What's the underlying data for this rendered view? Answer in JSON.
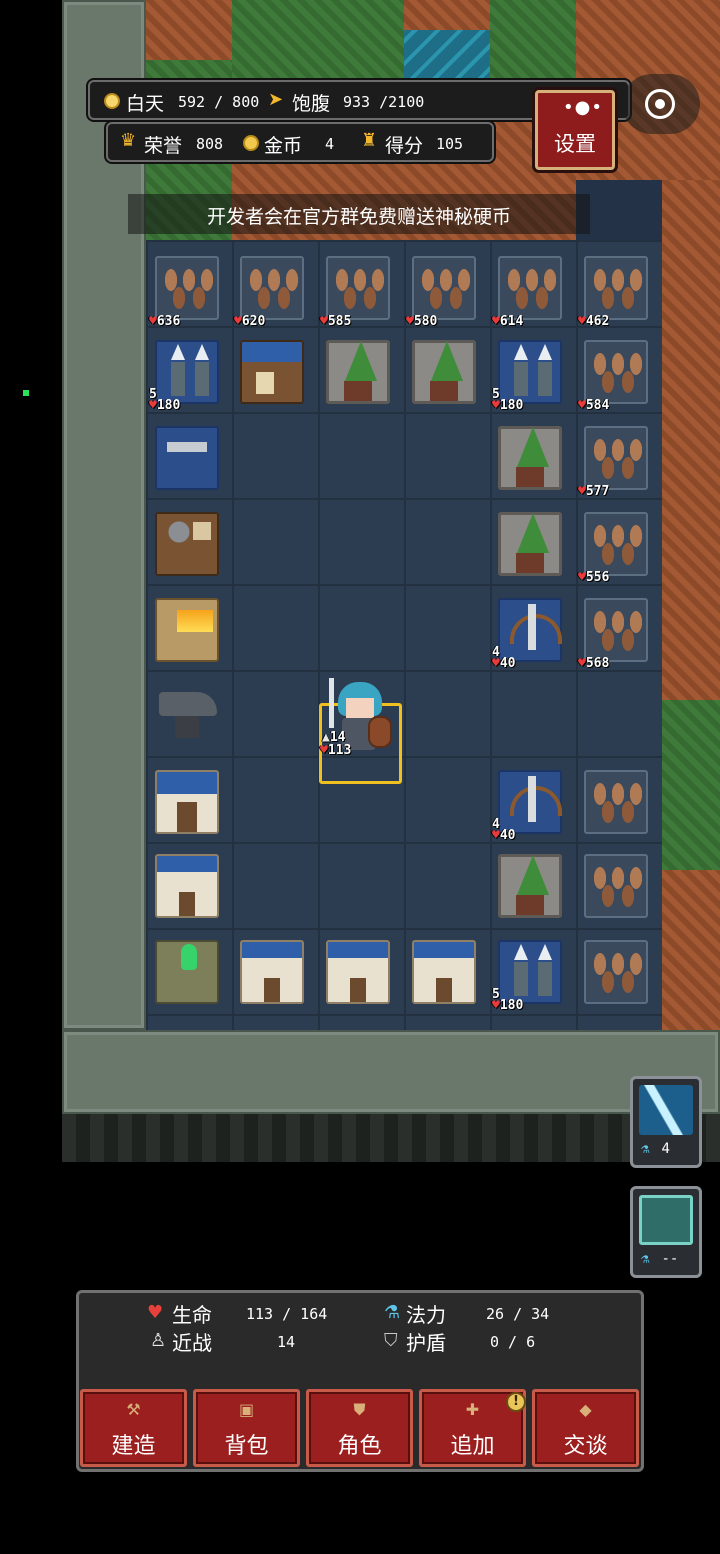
{
  "hud": {
    "day_label": "白天",
    "day_value": "592 / 800",
    "hunger_label": "饱腹",
    "hunger_value": "933 /2100",
    "honor_label": "荣誉",
    "honor_value": "808",
    "gold_label": "金币",
    "gold_value": "4",
    "score_label": "得分",
    "score_value": "105",
    "settings_label": "设置"
  },
  "notice": "开发者会在官方群免费赠送神秘硬币",
  "tiles": [
    {
      "type": "spikes",
      "hp": "636"
    },
    {
      "type": "spikes",
      "hp": "620"
    },
    {
      "type": "spikes",
      "hp": "585"
    },
    {
      "type": "spikes",
      "hp": "580"
    },
    {
      "type": "spikes",
      "hp": "614"
    },
    {
      "type": "spikes",
      "hp": "462"
    },
    {
      "type": "archer",
      "atk": "5",
      "hp": "180"
    },
    {
      "type": "shop"
    },
    {
      "type": "tree"
    },
    {
      "type": "tree"
    },
    {
      "type": "archer",
      "atk": "5",
      "hp": "180"
    },
    {
      "type": "spikes",
      "hp": "584"
    },
    {
      "type": "workbench"
    },
    {
      "type": "tree"
    },
    {
      "type": "spikes",
      "hp": "577"
    },
    {
      "type": "stove"
    },
    {
      "type": "tree"
    },
    {
      "type": "spikes",
      "hp": "556"
    },
    {
      "type": "furnace"
    },
    {
      "type": "ballista",
      "atk": "4",
      "hp": "40"
    },
    {
      "type": "spikes",
      "hp": "568"
    },
    {
      "type": "anvil"
    },
    {
      "type": "temple"
    },
    {
      "type": "ballista",
      "atk": "4",
      "hp": "40"
    },
    {
      "type": "spikes"
    },
    {
      "type": "house"
    },
    {
      "type": "tree"
    },
    {
      "type": "spikes"
    },
    {
      "type": "altar"
    },
    {
      "type": "house"
    },
    {
      "type": "house"
    },
    {
      "type": "house"
    },
    {
      "type": "archer",
      "atk": "5",
      "hp": "180"
    },
    {
      "type": "spikes"
    }
  ],
  "hero": {
    "atk": "14",
    "hp": "113"
  },
  "skills": [
    {
      "name": "lightning-skill",
      "cost": "4",
      "color": "#4aa8d8"
    },
    {
      "name": "shield-skill",
      "cost": "--",
      "color": "#2f8f86"
    }
  ],
  "stats": {
    "life_label": "生命",
    "life_value": "113 / 164",
    "mana_label": "法力",
    "mana_value": "26 / 34",
    "melee_label": "近战",
    "melee_value": "14",
    "shield_label": "护盾",
    "shield_value": "0 / 6"
  },
  "menu": [
    {
      "label": "建造",
      "icon": "hammer-icon"
    },
    {
      "label": "背包",
      "icon": "bag-icon"
    },
    {
      "label": "角色",
      "icon": "character-icon"
    },
    {
      "label": "追加",
      "icon": "plus-icon"
    },
    {
      "label": "交谈",
      "icon": "chat-icon"
    }
  ],
  "badge": "!"
}
